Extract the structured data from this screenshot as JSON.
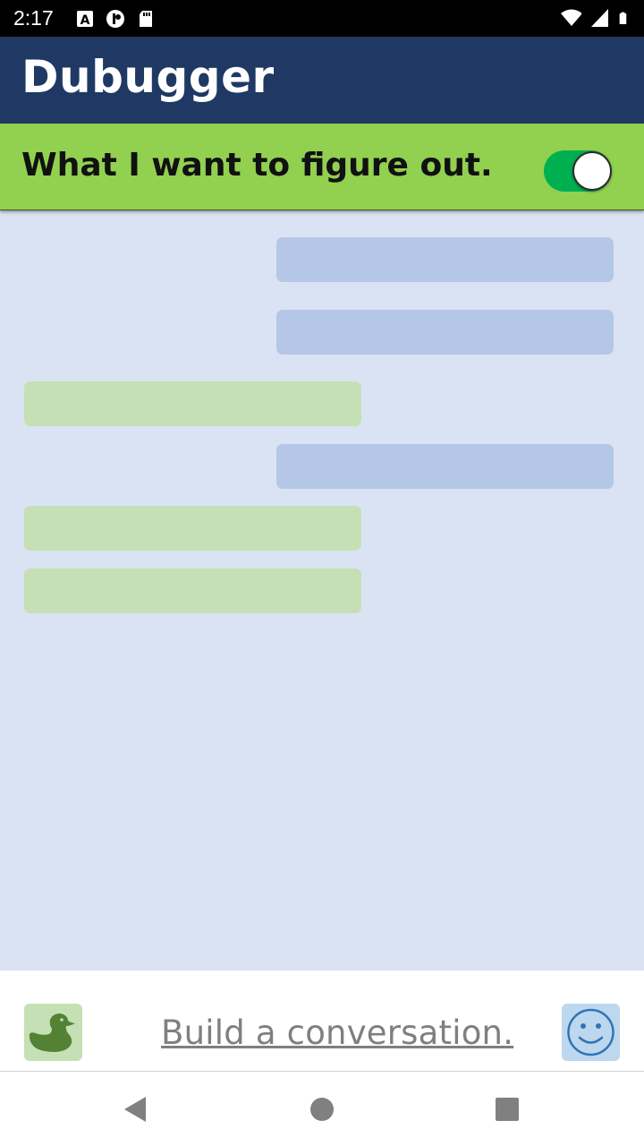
{
  "status_bar": {
    "time": "2:17",
    "left_icons": [
      "accessibility-a-icon",
      "notification-app-icon",
      "sd-card-icon"
    ],
    "right_icons": [
      "wifi-icon",
      "cell-signal-icon",
      "battery-icon"
    ]
  },
  "app_bar": {
    "title": "Dubugger",
    "background_color": "#203864"
  },
  "topic": {
    "text": "What I want to figure out.",
    "toggle_on": true,
    "background_color": "#92d050",
    "toggle_color": "#00b050"
  },
  "chat": {
    "background_color": "#dae3f3",
    "messages": [
      {
        "side": "right",
        "text": ""
      },
      {
        "side": "right",
        "text": ""
      },
      {
        "side": "left",
        "text": ""
      },
      {
        "side": "right",
        "text": ""
      },
      {
        "side": "left",
        "text": ""
      },
      {
        "side": "left",
        "text": ""
      }
    ]
  },
  "input_bar": {
    "placeholder": "Build a conversation.",
    "left_button_icon": "duck-icon",
    "right_button_icon": "smiley-face-icon"
  },
  "nav_bar": {
    "buttons": [
      "back-triangle-icon",
      "home-circle-icon",
      "recents-square-icon"
    ]
  }
}
